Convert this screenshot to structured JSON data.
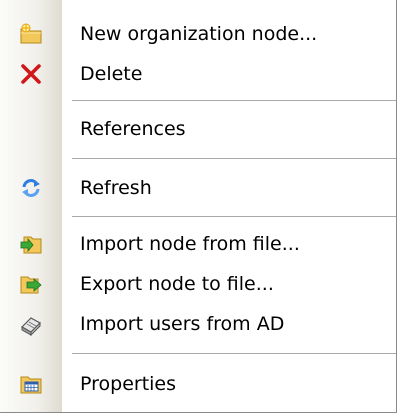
{
  "menu": {
    "items": [
      {
        "label": "New organization node...",
        "icon": "new-node-icon"
      },
      {
        "label": "Delete",
        "icon": "delete-x-icon"
      },
      {
        "label": "References",
        "icon": ""
      },
      {
        "label": "Refresh",
        "icon": "refresh-icon"
      },
      {
        "label": "Import node from file...",
        "icon": "import-node-icon"
      },
      {
        "label": "Export node to file...",
        "icon": "export-node-icon"
      },
      {
        "label": "Import users from AD",
        "icon": "import-users-icon"
      },
      {
        "label": "Properties",
        "icon": "properties-icon"
      }
    ]
  },
  "colors": {
    "delete_red": "#d0181c",
    "refresh_blue": "#2f7fe0",
    "folder_yellow": "#f3c85a",
    "green_arrow": "#3aa836",
    "separator": "#a9a9a9"
  }
}
